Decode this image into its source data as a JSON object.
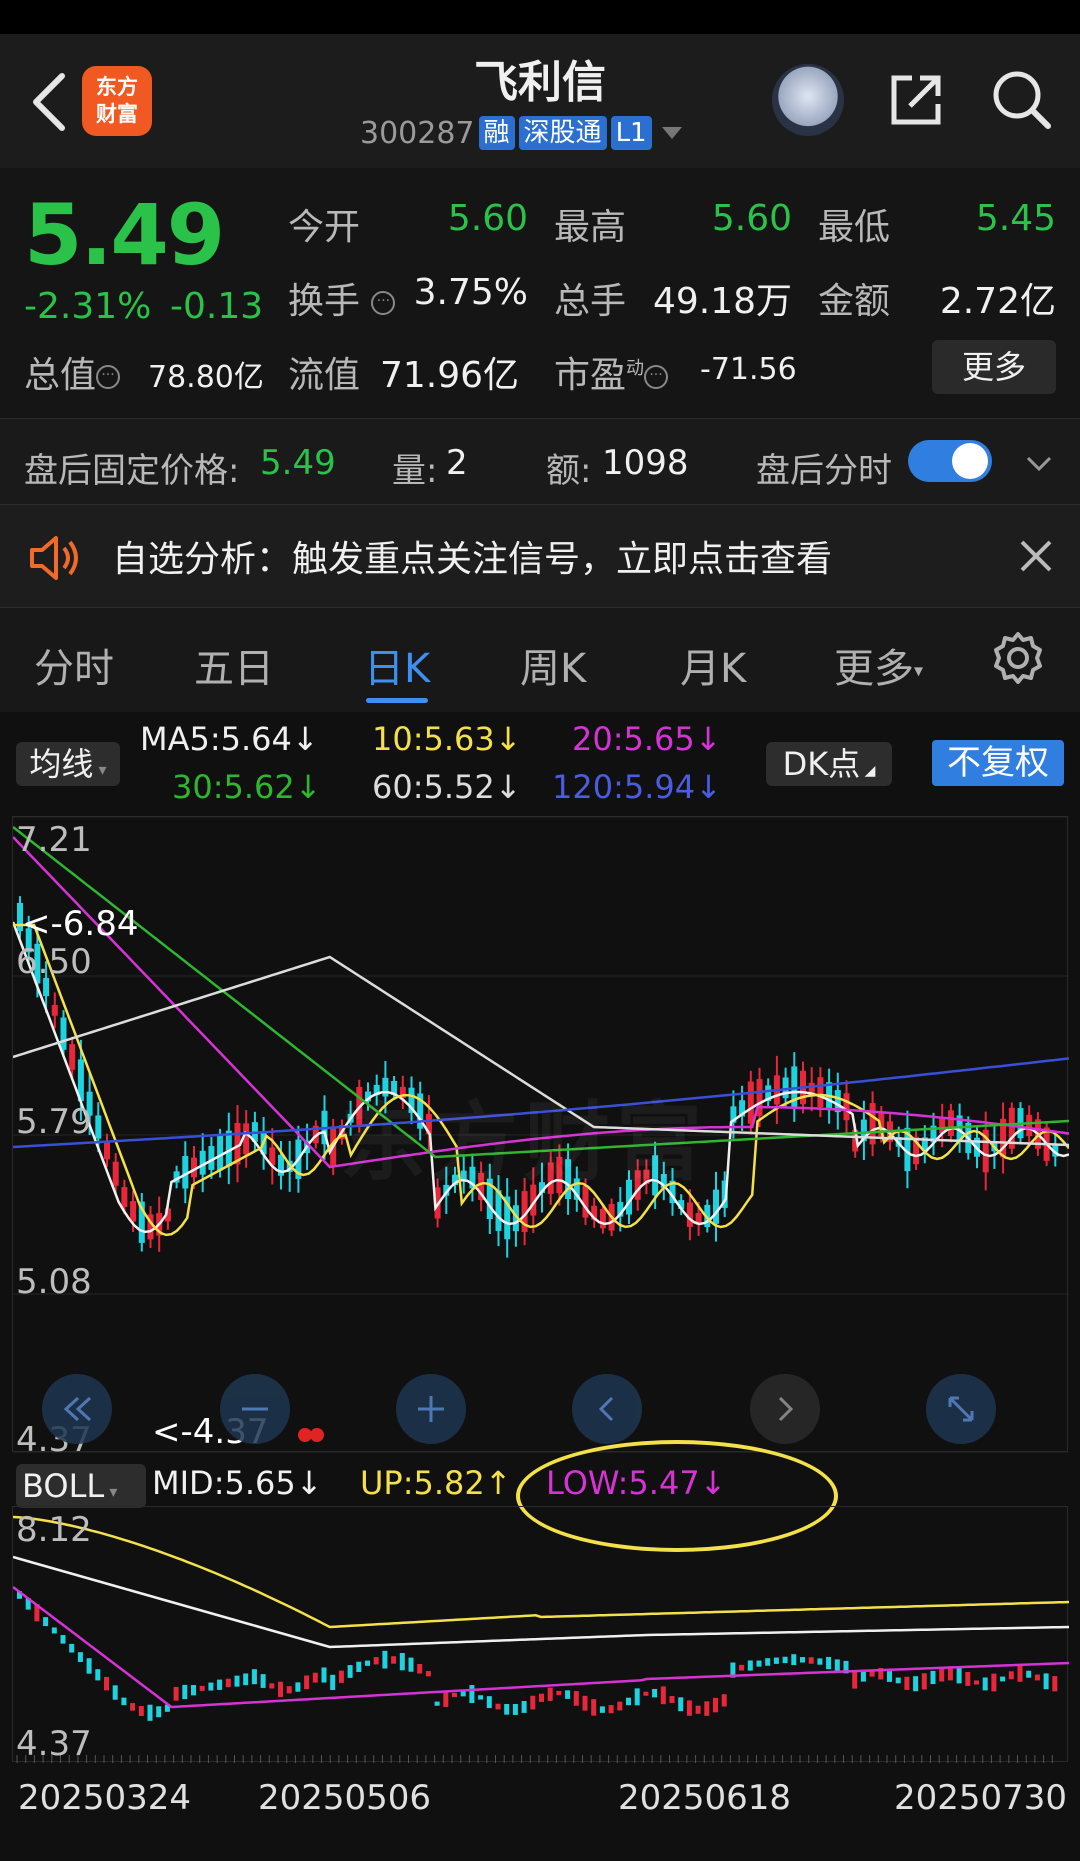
{
  "header": {
    "title": "飞利信",
    "code": "300287",
    "tags": [
      "融",
      "深股通",
      "L1"
    ],
    "logo_line1": "东方",
    "logo_line2": "财富"
  },
  "quote": {
    "price": "5.49",
    "change_pct": "-2.31%",
    "change_abs": "-0.13",
    "open_label": "今开",
    "open": "5.60",
    "high_label": "最高",
    "high": "5.60",
    "low_label": "最低",
    "low": "5.45",
    "turnover_label": "换手",
    "turnover": "3.75%",
    "volume_label": "总手",
    "volume": "49.18万",
    "amount_label": "金额",
    "amount": "2.72亿",
    "mktcap_label": "总值",
    "mktcap": "78.80亿",
    "float_label": "流值",
    "float": "71.96亿",
    "pe_label": "市盈",
    "pe_sup": "动",
    "pe": "-71.56",
    "more": "更多"
  },
  "after_hours": {
    "price_label": "盘后固定价格:",
    "price": "5.49",
    "vol_label": "量:",
    "vol": "2",
    "amt_label": "额:",
    "amt": "1098",
    "toggle_label": "盘后分时",
    "toggle_on": true
  },
  "notice": {
    "text": "自选分析：触发重点关注信号，立即点击查看"
  },
  "tabs": [
    {
      "label": "分时"
    },
    {
      "label": "五日"
    },
    {
      "label": "日K",
      "active": true
    },
    {
      "label": "周K"
    },
    {
      "label": "月K"
    },
    {
      "label": "更多"
    }
  ],
  "ma": {
    "selector": "均线",
    "ma5": "MA5:5.64↓",
    "ma10": "10:5.63↓",
    "ma20": "20:5.65↓",
    "ma30": "30:5.62↓",
    "ma60": "60:5.52↓",
    "ma120": "120:5.94↓",
    "dk": "DK点",
    "fq": "不复权",
    "colors": {
      "ma5": "#f0f0f0",
      "ma10": "#f3e04a",
      "ma20": "#d633d6",
      "ma30": "#2fb52f",
      "ma60": "#dcdcdc",
      "ma120": "#4a5de0"
    }
  },
  "kchart": {
    "y_labels": [
      "7.21",
      "6.50",
      "5.79",
      "5.08",
      "4.37"
    ],
    "max_mark": "<-6.84",
    "min_mark": "<-4.37",
    "watermark": "东方财富"
  },
  "boll": {
    "selector": "BOLL",
    "mid": "MID:5.65↓",
    "up": "UP:5.82↑",
    "low": "LOW:5.47↓",
    "y_labels": [
      "8.12",
      "4.37"
    ],
    "colors": {
      "mid": "#f0f0f0",
      "up": "#f3e04a",
      "low": "#d633d6"
    }
  },
  "dates": [
    "20250324",
    "20250506",
    "20250618",
    "20250730"
  ]
}
